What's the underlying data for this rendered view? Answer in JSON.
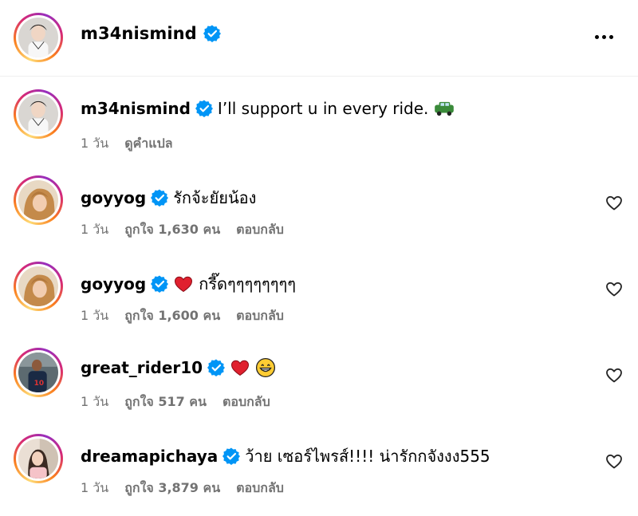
{
  "post_header": {
    "username": "m34nismind",
    "more_icon": "more-horizontal-icon"
  },
  "comments": [
    {
      "username": "m34nismind",
      "verified": true,
      "text": "I’ll support u in every ride.",
      "emoji": "car-emoji",
      "time": "1 วัน",
      "likes": "",
      "action1": "ดูคำแปล",
      "action2": ""
    },
    {
      "username": "goyyog",
      "verified": true,
      "text": "รักจ้ะยัยน้อง",
      "time": "1 วัน",
      "likes": "ถูกใจ 1,630 คน",
      "action2": "ตอบกลับ"
    },
    {
      "username": "goyyog",
      "verified": true,
      "emoji": "red-heart-emoji",
      "text": "กรี๊ดๆๆๆๆๆๆๆๆ",
      "time": "1 วัน",
      "likes": "ถูกใจ 1,600 คน",
      "action2": "ตอบกลับ"
    },
    {
      "username": "great_rider10",
      "verified": true,
      "emoji": "red-heart-emoji",
      "emoji2": "grinning-face-emoji",
      "text": "",
      "time": "1 วัน",
      "likes": "ถูกใจ 517 คน",
      "action2": "ตอบกลับ"
    },
    {
      "username": "dreamapichaya",
      "verified": true,
      "text": "ว้าย เซอร์ไพรส์!!!! น่ารักกจังงง555",
      "time": "1 วัน",
      "likes": "ถูกใจ 3,879 คน",
      "action2": "ตอบกลับ"
    }
  ],
  "colors": {
    "verified_blue": "#0095f6",
    "meta_gray": "#737373",
    "divider": "#efefef"
  }
}
